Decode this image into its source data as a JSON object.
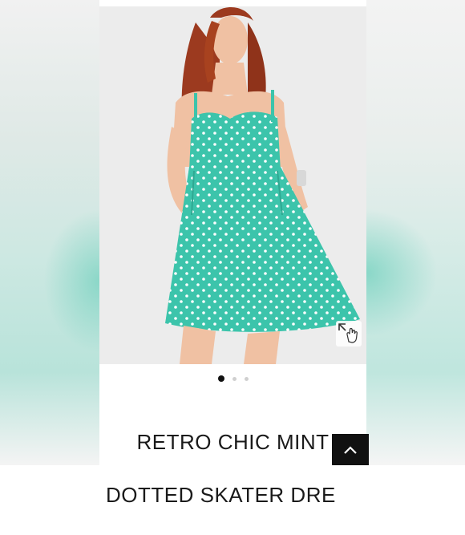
{
  "product": {
    "title_line1": "RETRO CHIC MINT",
    "title_line2": "DOTTED SKATER DRE",
    "image_alt": "model wearing mint polka dot skater dress"
  },
  "carousel": {
    "slide_count": 3,
    "active_index": 0
  },
  "icons": {
    "zoom": "expand-with-hand-icon",
    "scroll_top": "chevron-up-icon"
  },
  "colors": {
    "dress": "#3cc4ab",
    "dot": "#ffffff",
    "photo_bg": "#ececec",
    "hair": "#9c3a1f",
    "skin": "#f0c1a3",
    "scroll_button": "#111111"
  }
}
